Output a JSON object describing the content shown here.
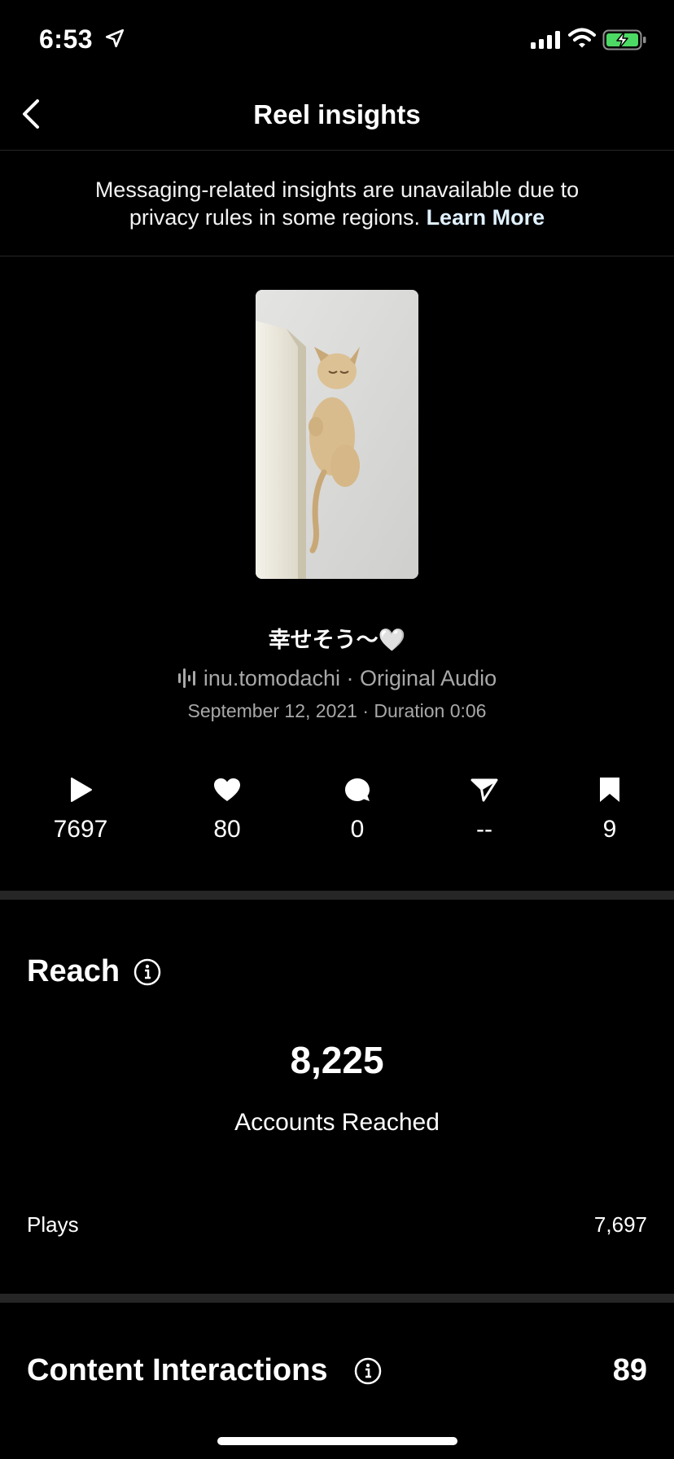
{
  "status_bar": {
    "time": "6:53",
    "icons": [
      "location-arrow-icon",
      "cellular-signal-icon",
      "wifi-icon",
      "battery-charging-icon"
    ]
  },
  "header": {
    "title": "Reel insights",
    "back_icon": "chevron-left-icon"
  },
  "notice": {
    "text": "Messaging-related insights are unavailable due to privacy rules in some regions.",
    "link_label": "Learn More"
  },
  "reel": {
    "caption": "幸せそう〜🤍",
    "audio": "inu.tomodachi · Original Audio",
    "meta": "September 12, 2021 · Duration 0:06"
  },
  "stats": [
    {
      "icon": "play-icon",
      "value": "7697"
    },
    {
      "icon": "heart-icon",
      "value": "80"
    },
    {
      "icon": "comment-icon",
      "value": "0"
    },
    {
      "icon": "share-icon",
      "value": "--"
    },
    {
      "icon": "bookmark-icon",
      "value": "9"
    }
  ],
  "reach": {
    "title": "Reach",
    "accounts_reached_value": "8,225",
    "accounts_reached_label": "Accounts Reached",
    "plays_label": "Plays",
    "plays_value": "7,697"
  },
  "content_interactions": {
    "title": "Content Interactions",
    "value": "89"
  },
  "colors": {
    "background": "#000000",
    "divider": "#262626",
    "secondary_text": "#a8a8a8",
    "battery_green": "#4cd964"
  }
}
